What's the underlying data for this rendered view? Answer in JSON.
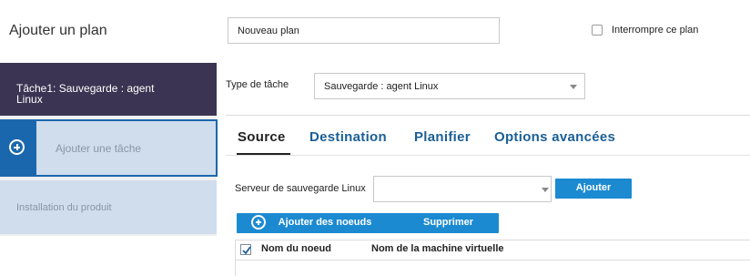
{
  "header": {
    "title": "Ajouter un plan",
    "plan_name_value": "Nouveau plan",
    "pause_plan_label": "Interrompre ce plan",
    "pause_plan_checked": false
  },
  "sidebar": {
    "task1_label": "Tâche1: Sauvegarde : agent Linux",
    "add_task_label": "Ajouter une tâche",
    "install_label": "Installation du produit"
  },
  "task_type": {
    "label": "Type de tâche",
    "selected": "Sauvegarde : agent Linux"
  },
  "tabs": [
    {
      "label": "Source",
      "active": true
    },
    {
      "label": "Destination",
      "active": false
    },
    {
      "label": "Planifier",
      "active": false
    },
    {
      "label": "Options avancées",
      "active": false
    }
  ],
  "source": {
    "server_label": "Serveur de sauvegarde Linux",
    "server_value": "",
    "add_button": "Ajouter",
    "add_nodes_button": "Ajouter des noeuds",
    "delete_button": "Supprimer"
  },
  "table": {
    "header_checked": true,
    "columns": [
      "Nom du noeud",
      "Nom de la machine virtuelle"
    ]
  },
  "colors": {
    "sidebar_active": "#3b3452",
    "accent": "#1b67ae",
    "button": "#1b8ad1",
    "tab_link": "#1b5f96"
  }
}
